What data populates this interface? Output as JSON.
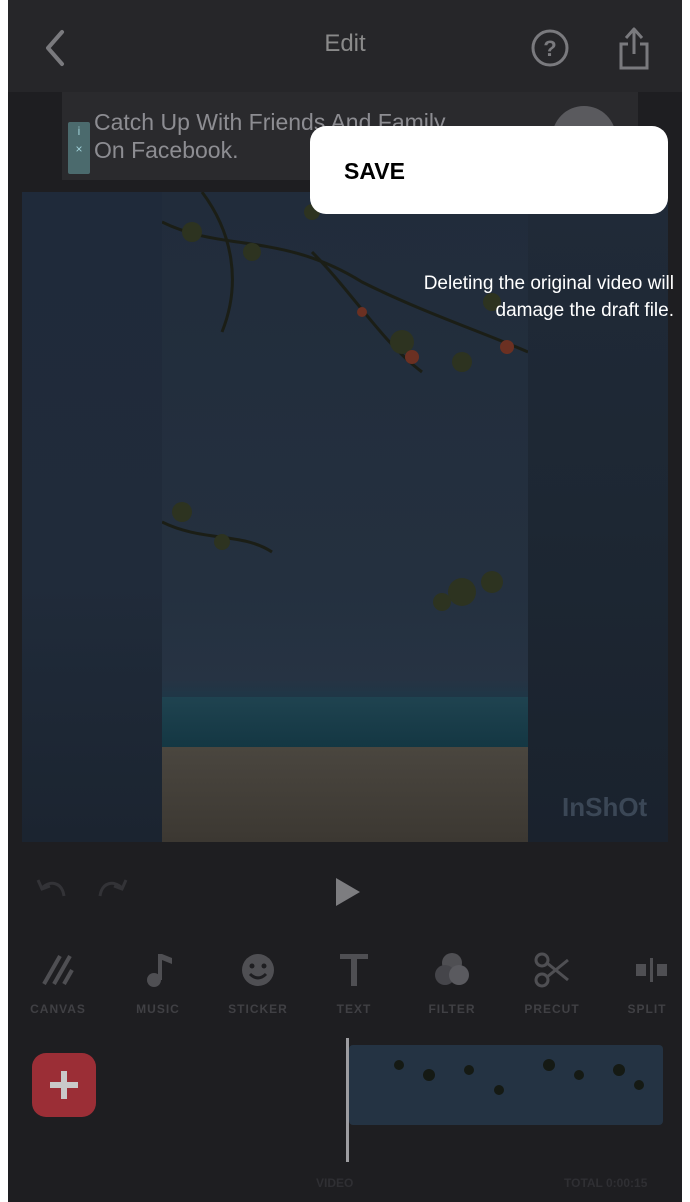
{
  "header": {
    "title": "Edit"
  },
  "ad": {
    "text_line1": "Catch Up With Friends And Family",
    "text_line2": "On Facebook.",
    "badge_i": "i",
    "badge_x": "×"
  },
  "preview": {
    "watermark": "InShOt"
  },
  "popup": {
    "save_label": "SAVE",
    "warning_line1": "Deleting the original video will",
    "warning_line2": "damage the draft file."
  },
  "toolbar": {
    "items": [
      {
        "label": "CANVAS",
        "icon": "canvas-icon"
      },
      {
        "label": "MUSIC",
        "icon": "music-icon"
      },
      {
        "label": "STICKER",
        "icon": "sticker-icon"
      },
      {
        "label": "TEXT",
        "icon": "text-icon"
      },
      {
        "label": "FILTER",
        "icon": "filter-icon"
      },
      {
        "label": "PRECUT",
        "icon": "scissors-icon"
      },
      {
        "label": "SPLIT",
        "icon": "split-icon"
      }
    ]
  },
  "timeline": {
    "left_label": "VIDEO",
    "right_label": "TOTAL 0:00:15"
  },
  "colors": {
    "background": "#1e1e21",
    "popup": "#ffffff",
    "add_button": "#9b2e36"
  }
}
